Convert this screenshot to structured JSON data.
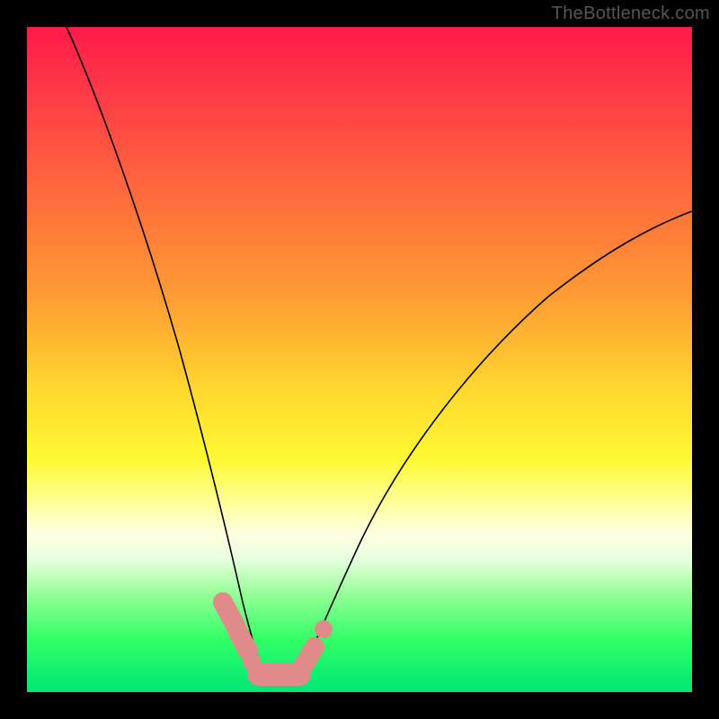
{
  "watermark": "TheBottleneck.com",
  "colors": {
    "frame": "#000000",
    "gradient_top": "#ff1a4b",
    "gradient_bottom": "#00e676",
    "curve": "#000000",
    "marker": "#e08a8a"
  },
  "chart_data": {
    "type": "line",
    "title": "",
    "xlabel": "",
    "ylabel": "",
    "xlim": [
      0,
      100
    ],
    "ylim": [
      0,
      100
    ],
    "note": "Axes are unlabeled; values are estimated from normalized 0–100 plot coordinates (y=0 at bottom, x=0 at left).",
    "series": [
      {
        "name": "left-curve",
        "x": [
          6,
          10,
          14,
          18,
          22,
          25,
          27,
          29,
          31,
          32.5,
          33.5,
          34.5,
          35.5
        ],
        "y": [
          100,
          88,
          74,
          60,
          46,
          34,
          26,
          18,
          12,
          8,
          5,
          3,
          2
        ]
      },
      {
        "name": "right-curve",
        "x": [
          41,
          43,
          45,
          48,
          52,
          57,
          63,
          70,
          78,
          88,
          100
        ],
        "y": [
          2,
          4,
          8,
          14,
          22,
          31,
          40,
          49,
          57,
          65,
          72
        ]
      }
    ],
    "floor_segment": {
      "x_start": 34,
      "x_end": 41,
      "y": 2
    },
    "markers": [
      {
        "shape": "pill",
        "x_start": 29.5,
        "x_end": 31.5,
        "y": 12
      },
      {
        "shape": "pill",
        "x_start": 31.5,
        "x_end": 33.0,
        "y": 7
      },
      {
        "shape": "dot",
        "x": 33.5,
        "y": 4
      },
      {
        "shape": "pill",
        "x_start": 34.5,
        "x_end": 41.0,
        "y": 2
      },
      {
        "shape": "pill",
        "x_start": 41.5,
        "x_end": 43.0,
        "y": 4.5
      },
      {
        "shape": "dot",
        "x": 44.5,
        "y": 9
      }
    ]
  }
}
